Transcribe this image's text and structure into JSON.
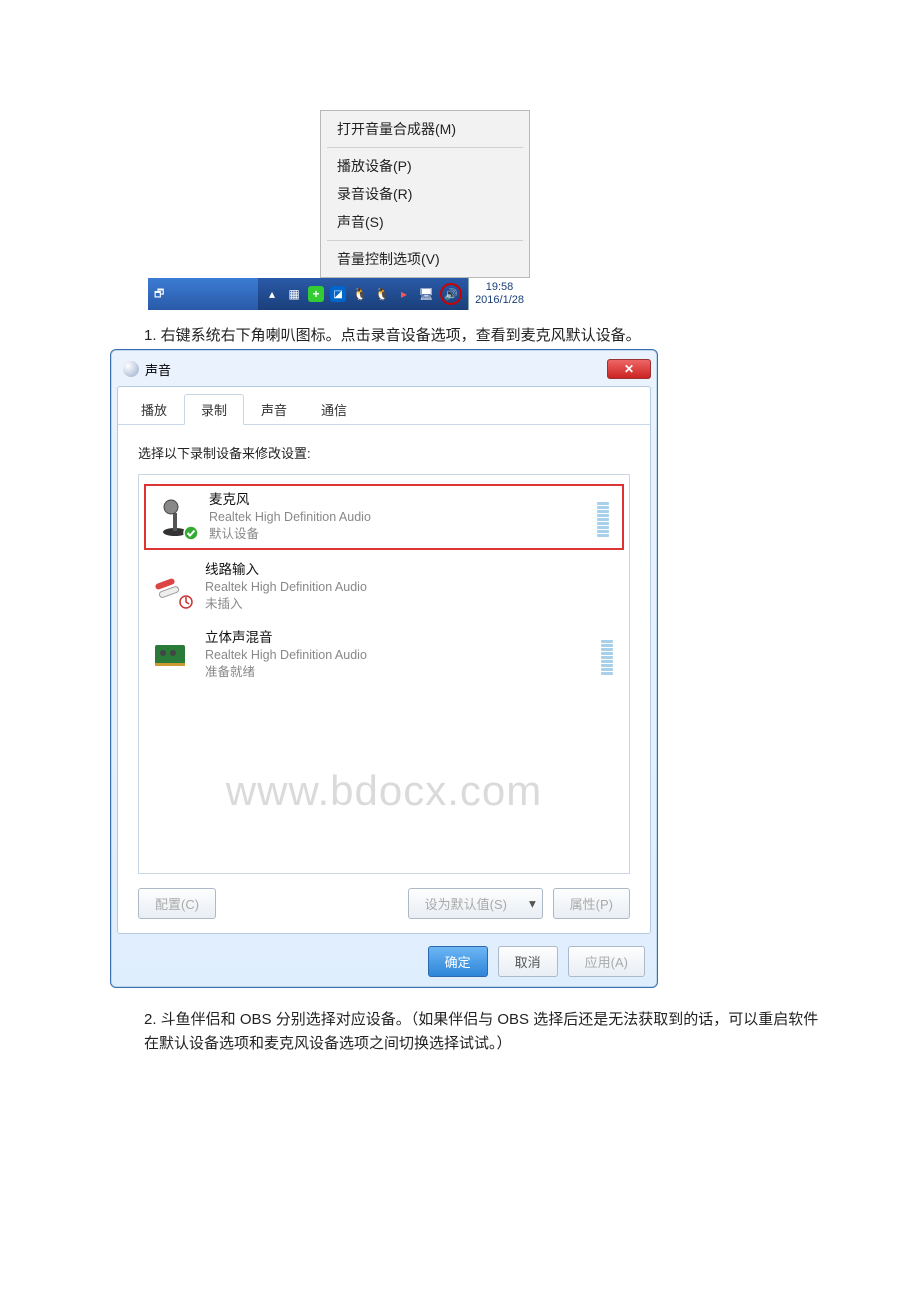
{
  "context_menu": {
    "items": [
      "打开音量合成器(M)",
      "播放设备(P)",
      "录音设备(R)",
      "声音(S)",
      "音量控制选项(V)"
    ]
  },
  "clock": {
    "time": "19:58",
    "date": "2016/1/28"
  },
  "instruction_1": "1. 右键系统右下角喇叭图标。点击录音设备选项，查看到麦克风默认设备。",
  "instruction_2": "2. 斗鱼伴侣和 OBS 分别选择对应设备。（如果伴侣与 OBS 选择后还是无法获取到的话，可以重启软件在默认设备选项和麦克风设备选项之间切换选择试试。）",
  "dialog": {
    "title": "声音",
    "close": "✕",
    "tabs": [
      "播放",
      "录制",
      "声音",
      "通信"
    ],
    "active_tab": 1,
    "label": "选择以下录制设备来修改设置:",
    "devices": [
      {
        "name": "麦克风",
        "desc": "Realtek High Definition Audio",
        "status": "默认设备",
        "meter": true
      },
      {
        "name": "线路输入",
        "desc": "Realtek High Definition Audio",
        "status": "未插入",
        "meter": false
      },
      {
        "name": "立体声混音",
        "desc": "Realtek High Definition Audio",
        "status": "准备就绪",
        "meter": true
      }
    ],
    "buttons": {
      "configure": "配置(C)",
      "set_default": "设为默认值(S)",
      "properties": "属性(P)",
      "ok": "确定",
      "cancel": "取消",
      "apply": "应用(A)"
    }
  },
  "watermark": "www.bdocx.com"
}
